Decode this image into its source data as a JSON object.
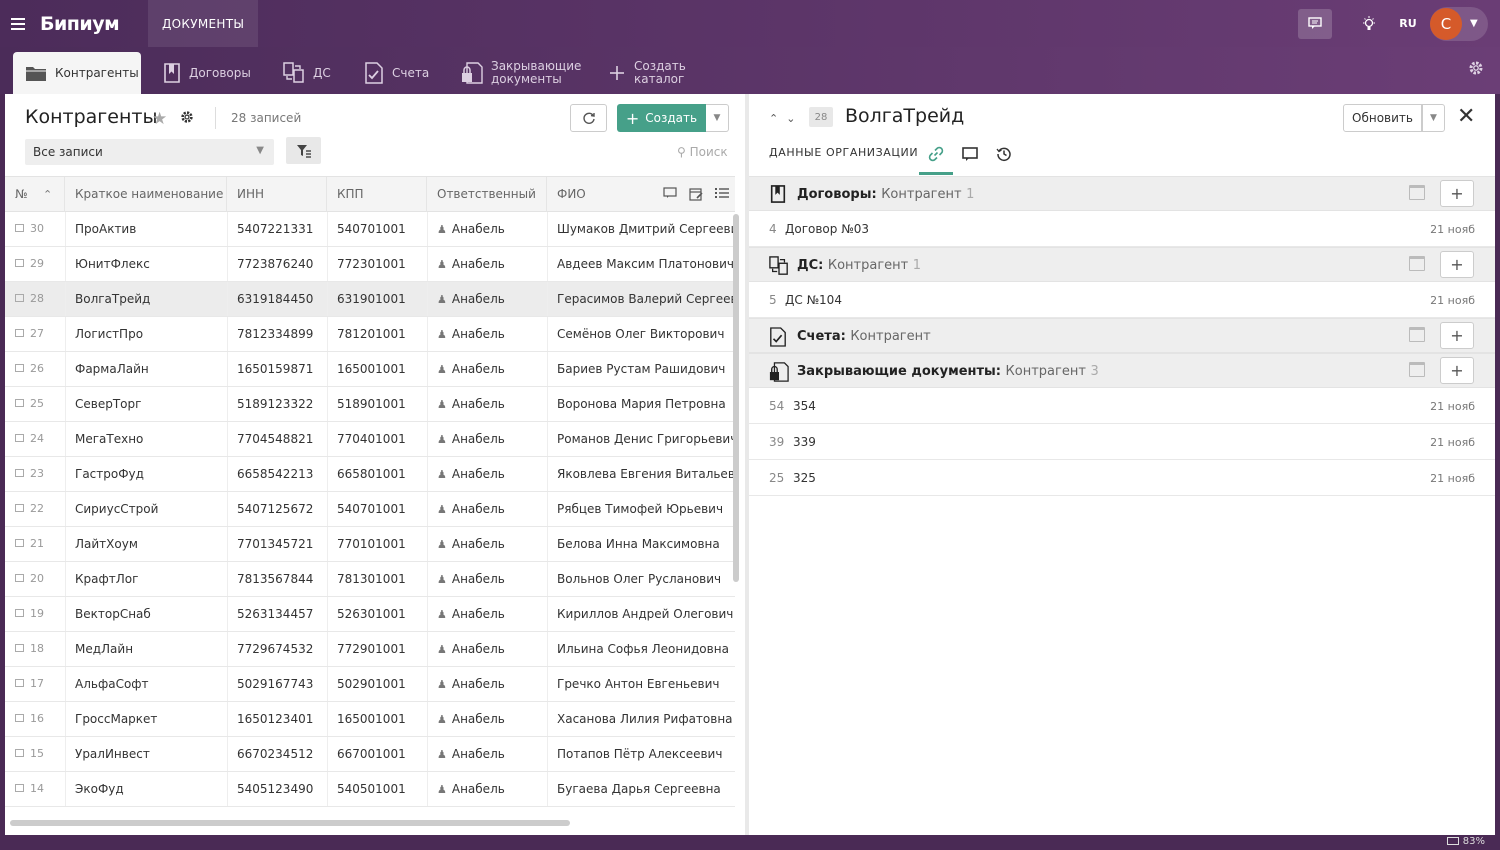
{
  "app": {
    "brand": "Бипиум",
    "top_tab": "ДОКУМЕНТЫ",
    "lang": "RU",
    "user_initial": "С"
  },
  "catalogs": [
    {
      "label": "Контрагенты",
      "icon": "folder-icon",
      "active": true
    },
    {
      "label": "Договоры",
      "icon": "contract-icon",
      "active": false
    },
    {
      "label": "ДС",
      "icon": "ds-icon",
      "active": false
    },
    {
      "label": "Счета",
      "icon": "invoice-icon",
      "active": false
    },
    {
      "label": "Закрывающие документы",
      "icon": "lock-document-icon",
      "active": false
    },
    {
      "label": "Создать каталог",
      "icon": "plus-icon",
      "active": false
    }
  ],
  "left": {
    "title": "Контрагенты",
    "count": "28 записей",
    "create_label": "Создать",
    "filter_value": "Все записи",
    "search_placeholder": "Поиск",
    "columns": [
      "№",
      "Краткое наименование",
      "ИНН",
      "КПП",
      "Ответственный",
      "ФИО"
    ],
    "rows": [
      {
        "num": "30",
        "name": "ПроАктив",
        "inn": "5407221331",
        "kpp": "540701001",
        "resp": "Анабель",
        "fio": "Шумаков Дмитрий Сергеевич"
      },
      {
        "num": "29",
        "name": "ЮнитФлекс",
        "inn": "7723876240",
        "kpp": "772301001",
        "resp": "Анабель",
        "fio": "Авдеев Максим Платонович"
      },
      {
        "num": "28",
        "name": "ВолгаТрейд",
        "inn": "6319184450",
        "kpp": "631901001",
        "resp": "Анабель",
        "fio": "Герасимов Валерий Сергеевич"
      },
      {
        "num": "27",
        "name": "ЛогистПро",
        "inn": "7812334899",
        "kpp": "781201001",
        "resp": "Анабель",
        "fio": "Семёнов Олег Викторович"
      },
      {
        "num": "26",
        "name": "ФармаЛайн",
        "inn": "1650159871",
        "kpp": "165001001",
        "resp": "Анабель",
        "fio": "Бариев Рустам Рашидович"
      },
      {
        "num": "25",
        "name": "СеверТорг",
        "inn": "5189123322",
        "kpp": "518901001",
        "resp": "Анабель",
        "fio": "Воронова Мария Петровна"
      },
      {
        "num": "24",
        "name": "МегаТехно",
        "inn": "7704548821",
        "kpp": "770401001",
        "resp": "Анабель",
        "fio": "Романов Денис Григорьевич"
      },
      {
        "num": "23",
        "name": "ГастроФуд",
        "inn": "6658542213",
        "kpp": "665801001",
        "resp": "Анабель",
        "fio": "Яковлева Евгения Витальевна"
      },
      {
        "num": "22",
        "name": "СириусСтрой",
        "inn": "5407125672",
        "kpp": "540701001",
        "resp": "Анабель",
        "fio": "Рябцев Тимофей Юрьевич"
      },
      {
        "num": "21",
        "name": "ЛайтХоум",
        "inn": "7701345721",
        "kpp": "770101001",
        "resp": "Анабель",
        "fio": "Белова Инна Максимовна"
      },
      {
        "num": "20",
        "name": "КрафтЛог",
        "inn": "7813567844",
        "kpp": "781301001",
        "resp": "Анабель",
        "fio": "Вольнов Олег Русланович"
      },
      {
        "num": "19",
        "name": "ВекторСнаб",
        "inn": "5263134457",
        "kpp": "526301001",
        "resp": "Анабель",
        "fio": "Кириллов Андрей Олегович"
      },
      {
        "num": "18",
        "name": "МедЛайн",
        "inn": "7729674532",
        "kpp": "772901001",
        "resp": "Анабель",
        "fio": "Ильина Софья Леонидовна"
      },
      {
        "num": "17",
        "name": "АльфаСофт",
        "inn": "5029167743",
        "kpp": "502901001",
        "resp": "Анабель",
        "fio": "Гречко Антон Евгеньевич"
      },
      {
        "num": "16",
        "name": "ГроссМаркет",
        "inn": "1650123401",
        "kpp": "165001001",
        "resp": "Анабель",
        "fio": "Хасанова Лилия Рифатовна"
      },
      {
        "num": "15",
        "name": "УралИнвест",
        "inn": "6670234512",
        "kpp": "667001001",
        "resp": "Анабель",
        "fio": "Потапов Пётр Алексеевич"
      },
      {
        "num": "14",
        "name": "ЭкоФуд",
        "inn": "5405123490",
        "kpp": "540501001",
        "resp": "Анабель",
        "fio": "Бугаева Дарья Сергеевна"
      }
    ],
    "selected_row": "28"
  },
  "right": {
    "record_num": "28",
    "title": "ВолгаТрейд",
    "update_label": "Обновить",
    "tab_label": "ДАННЫЕ ОРГАНИЗАЦИИ",
    "sections": [
      {
        "title": "Договоры:",
        "sub": "Контрагент",
        "count": "1",
        "icon": "contract-icon",
        "items": [
          {
            "num": "4",
            "name": "Договор №03",
            "date": "21 нояб"
          }
        ]
      },
      {
        "title": "ДС:",
        "sub": "Контрагент",
        "count": "1",
        "icon": "ds-icon",
        "items": [
          {
            "num": "5",
            "name": "ДС №104",
            "date": "21 нояб"
          }
        ]
      },
      {
        "title": "Счета:",
        "sub": "Контрагент",
        "count": "",
        "icon": "invoice-icon",
        "items": []
      },
      {
        "title": "Закрывающие документы:",
        "sub": "Контрагент",
        "count": "3",
        "icon": "lock-document-icon",
        "items": [
          {
            "num": "54",
            "name": "354",
            "date": "21 нояб"
          },
          {
            "num": "39",
            "name": "339",
            "date": "21 нояб"
          },
          {
            "num": "25",
            "name": "325",
            "date": "21 нояб"
          }
        ]
      }
    ]
  },
  "status": {
    "zoom": "83%"
  },
  "colors": {
    "accent": "#46a089",
    "header_dark": "#4c2c5a",
    "header_light": "#6a3d75",
    "avatar": "#d55a2a"
  }
}
